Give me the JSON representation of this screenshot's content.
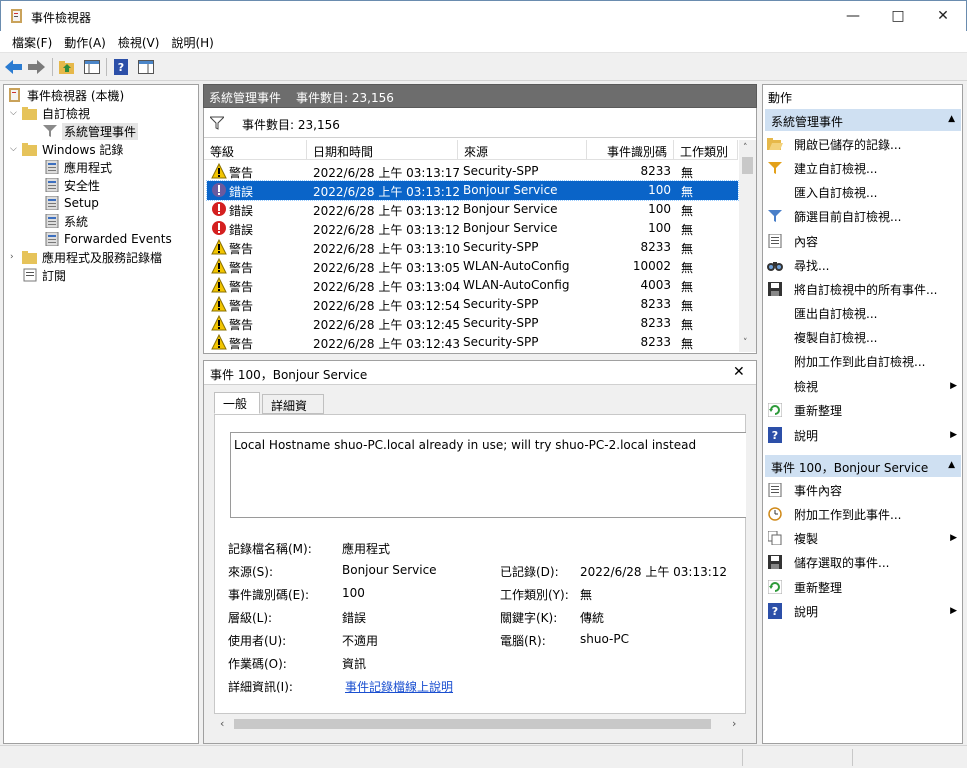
{
  "window": {
    "title": "事件檢視器"
  },
  "menu": [
    "檔案(F)",
    "動作(A)",
    "檢視(V)",
    "說明(H)"
  ],
  "tree": {
    "root": "事件檢視器 (本機)",
    "custom_views": "自訂檢視",
    "admin_events": "系統管理事件",
    "windows_logs": "Windows 記錄",
    "application": "應用程式",
    "security": "安全性",
    "setup": "Setup",
    "system": "系統",
    "forwarded": "Forwarded Events",
    "app_service_logs": "應用程式及服務記錄檔",
    "subscriptions": "訂閱"
  },
  "middle": {
    "header_title": "系統管理事件",
    "header_count": "事件數目: 23,156",
    "filter_count": "事件數目: 23,156",
    "columns": [
      "等級",
      "日期和時間",
      "來源",
      "事件識別碼",
      "工作類別"
    ],
    "rows": [
      {
        "level": "警告",
        "icon": "warning-icon",
        "datetime": "2022/6/28 上午 03:13:17",
        "source": "Security-SPP",
        "id": "8233",
        "category": "無"
      },
      {
        "level": "錯誤",
        "icon": "error-icon",
        "datetime": "2022/6/28 上午 03:13:12",
        "source": "Bonjour Service",
        "id": "100",
        "category": "無"
      },
      {
        "level": "錯誤",
        "icon": "error-icon",
        "datetime": "2022/6/28 上午 03:13:12",
        "source": "Bonjour Service",
        "id": "100",
        "category": "無"
      },
      {
        "level": "錯誤",
        "icon": "error-icon",
        "datetime": "2022/6/28 上午 03:13:12",
        "source": "Bonjour Service",
        "id": "100",
        "category": "無"
      },
      {
        "level": "警告",
        "icon": "warning-icon",
        "datetime": "2022/6/28 上午 03:13:10",
        "source": "Security-SPP",
        "id": "8233",
        "category": "無"
      },
      {
        "level": "警告",
        "icon": "warning-icon",
        "datetime": "2022/6/28 上午 03:13:05",
        "source": "WLAN-AutoConfig",
        "id": "10002",
        "category": "無"
      },
      {
        "level": "警告",
        "icon": "warning-icon",
        "datetime": "2022/6/28 上午 03:13:04",
        "source": "WLAN-AutoConfig",
        "id": "4003",
        "category": "無"
      },
      {
        "level": "警告",
        "icon": "warning-icon",
        "datetime": "2022/6/28 上午 03:12:54",
        "source": "Security-SPP",
        "id": "8233",
        "category": "無"
      },
      {
        "level": "警告",
        "icon": "warning-icon",
        "datetime": "2022/6/28 上午 03:12:45",
        "source": "Security-SPP",
        "id": "8233",
        "category": "無"
      },
      {
        "level": "警告",
        "icon": "warning-icon",
        "datetime": "2022/6/28 上午 03:12:43",
        "source": "Security-SPP",
        "id": "8233",
        "category": "無"
      }
    ]
  },
  "detail": {
    "title": "事件 100，Bonjour Service",
    "tab_general": "一般",
    "tab_details": "詳細資料",
    "message": "Local Hostname shuo-PC.local already in use; will try shuo-PC-2.local instead",
    "log_name_label": "記錄檔名稱(M):",
    "log_name": "應用程式",
    "source_label": "來源(S):",
    "source": "Bonjour Service",
    "logged_label": "已記錄(D):",
    "logged": "2022/6/28 上午 03:13:12",
    "event_id_label": "事件識別碼(E):",
    "event_id": "100",
    "task_category_label": "工作類別(Y):",
    "task_category": "無",
    "level_label": "層級(L):",
    "level": "錯誤",
    "keywords_label": "關鍵字(K):",
    "keywords": "傳統",
    "user_label": "使用者(U):",
    "user": "不適用",
    "computer_label": "電腦(R):",
    "computer": "shuo-PC",
    "opcode_label": "作業碼(O):",
    "opcode": "資訊",
    "more_info_label": "詳細資訊(I):",
    "more_info_link": "事件記錄檔線上說明"
  },
  "actions": {
    "title": "動作",
    "section1": "系統管理事件",
    "items1": [
      "開啟已儲存的記錄...",
      "建立自訂檢視...",
      "匯入自訂檢視...",
      "篩選目前自訂檢視...",
      "內容",
      "尋找...",
      "將自訂檢視中的所有事件...",
      "匯出自訂檢視...",
      "複製自訂檢視...",
      "附加工作到此自訂檢視...",
      "檢視",
      "重新整理",
      "說明"
    ],
    "section2": "事件 100，Bonjour Service",
    "items2": [
      "事件內容",
      "附加工作到此事件...",
      "複製",
      "儲存選取的事件...",
      "重新整理",
      "說明"
    ]
  }
}
